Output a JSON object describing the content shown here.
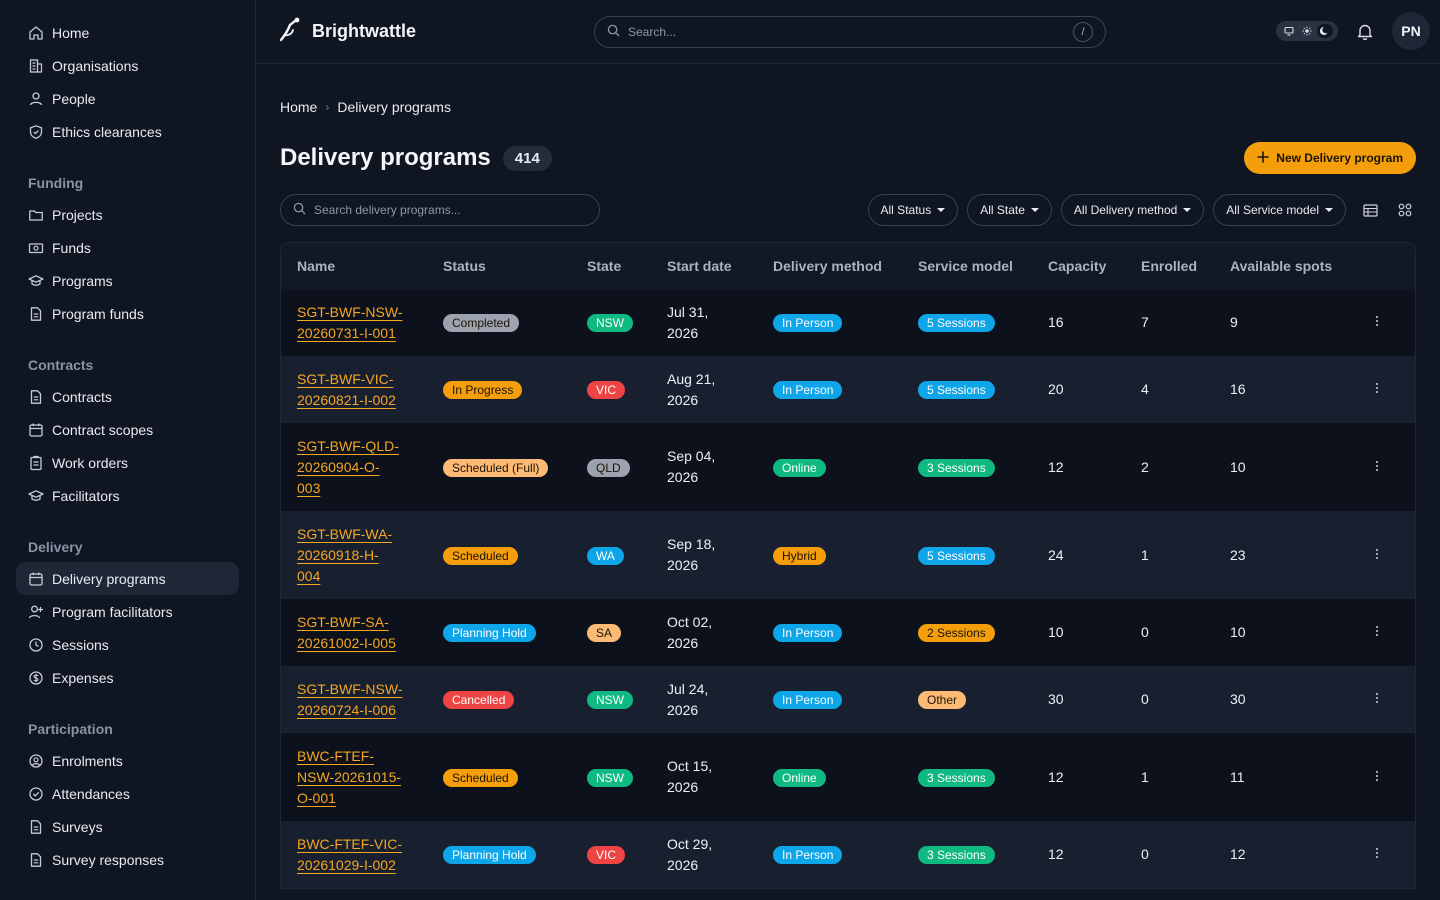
{
  "sidebar": {
    "top_items": [
      {
        "label": "Home",
        "icon": "home-icon"
      },
      {
        "label": "Organisations",
        "icon": "building-icon"
      },
      {
        "label": "People",
        "icon": "person-icon"
      },
      {
        "label": "Ethics clearances",
        "icon": "shield-icon"
      }
    ],
    "sections": [
      {
        "title": "Funding",
        "items": [
          {
            "label": "Projects",
            "icon": "folder-icon"
          },
          {
            "label": "Funds",
            "icon": "banknote-icon"
          },
          {
            "label": "Programs",
            "icon": "graduation-cap-icon"
          },
          {
            "label": "Program funds",
            "icon": "document-icon"
          }
        ]
      },
      {
        "title": "Contracts",
        "items": [
          {
            "label": "Contracts",
            "icon": "document-icon"
          },
          {
            "label": "Contract scopes",
            "icon": "calendar-icon"
          },
          {
            "label": "Work orders",
            "icon": "clipboard-icon"
          },
          {
            "label": "Facilitators",
            "icon": "graduation-cap-icon"
          }
        ]
      },
      {
        "title": "Delivery",
        "items": [
          {
            "label": "Delivery programs",
            "icon": "calendar-icon",
            "active": true
          },
          {
            "label": "Program facilitators",
            "icon": "user-plus-icon"
          },
          {
            "label": "Sessions",
            "icon": "clock-icon"
          },
          {
            "label": "Expenses",
            "icon": "dollar-circle-icon"
          }
        ]
      },
      {
        "title": "Participation",
        "items": [
          {
            "label": "Enrolments",
            "icon": "user-circle-icon"
          },
          {
            "label": "Attendances",
            "icon": "check-circle-icon"
          },
          {
            "label": "Surveys",
            "icon": "document-icon"
          },
          {
            "label": "Survey responses",
            "icon": "document-icon"
          }
        ]
      }
    ]
  },
  "topbar": {
    "brand": "Brightwattle",
    "search_placeholder": "Search...",
    "search_shortcut": "/",
    "avatar_initials": "PN"
  },
  "breadcrumb": {
    "home": "Home",
    "current": "Delivery programs"
  },
  "page": {
    "title": "Delivery programs",
    "count": "414",
    "new_button": "New Delivery program",
    "table_search_placeholder": "Search delivery programs..."
  },
  "filters": [
    "All Status",
    "All State",
    "All Delivery method",
    "All Service model"
  ],
  "table": {
    "headers": [
      "Name",
      "Status",
      "State",
      "Start date",
      "Delivery method",
      "Service model",
      "Capacity",
      "Enrolled",
      "Available spots"
    ],
    "rows": [
      {
        "name": [
          "SGT-BWF-NSW-",
          "20260731-I-001"
        ],
        "status": "Completed",
        "state": "NSW",
        "date": [
          "Jul 31,",
          "2026"
        ],
        "method": "In Person",
        "model": "5 Sessions",
        "capacity": "16",
        "enrolled": "7",
        "available": "9"
      },
      {
        "name": [
          "SGT-BWF-VIC-",
          "20260821-I-002"
        ],
        "status": "In Progress",
        "state": "VIC",
        "date": [
          "Aug 21,",
          "2026"
        ],
        "method": "In Person",
        "model": "5 Sessions",
        "capacity": "20",
        "enrolled": "4",
        "available": "16"
      },
      {
        "name": [
          "SGT-BWF-QLD-",
          "20260904-O-",
          "003"
        ],
        "status": "Scheduled (Full)",
        "state": "QLD",
        "date": [
          "Sep 04,",
          "2026"
        ],
        "method": "Online",
        "model": "3 Sessions",
        "capacity": "12",
        "enrolled": "2",
        "available": "10"
      },
      {
        "name": [
          "SGT-BWF-WA-",
          "20260918-H-",
          "004"
        ],
        "status": "Scheduled",
        "state": "WA",
        "date": [
          "Sep 18,",
          "2026"
        ],
        "method": "Hybrid",
        "model": "5 Sessions",
        "capacity": "24",
        "enrolled": "1",
        "available": "23"
      },
      {
        "name": [
          "SGT-BWF-SA-",
          "20261002-I-005"
        ],
        "status": "Planning Hold",
        "state": "SA",
        "date": [
          "Oct 02,",
          "2026"
        ],
        "method": "In Person",
        "model": "2 Sessions",
        "capacity": "10",
        "enrolled": "0",
        "available": "10"
      },
      {
        "name": [
          "SGT-BWF-NSW-",
          "20260724-I-006"
        ],
        "status": "Cancelled",
        "state": "NSW",
        "date": [
          "Jul 24,",
          "2026"
        ],
        "method": "In Person",
        "model": "Other",
        "capacity": "30",
        "enrolled": "0",
        "available": "30"
      },
      {
        "name": [
          "BWC-FTEF-",
          "NSW-20261015-",
          "O-001"
        ],
        "status": "Scheduled",
        "state": "NSW",
        "date": [
          "Oct 15,",
          "2026"
        ],
        "method": "Online",
        "model": "3 Sessions",
        "capacity": "12",
        "enrolled": "1",
        "available": "11"
      },
      {
        "name": [
          "BWC-FTEF-VIC-",
          "20261029-I-002"
        ],
        "status": "Planning Hold",
        "state": "VIC",
        "date": [
          "Oct 29,",
          "2026"
        ],
        "method": "In Person",
        "model": "3 Sessions",
        "capacity": "12",
        "enrolled": "0",
        "available": "12"
      }
    ]
  },
  "colors": {
    "accent": "#f59e0b",
    "status": {
      "Completed": "#9ca3af",
      "In Progress": "#f59e0b",
      "Scheduled (Full)": "#fdba74",
      "Scheduled": "#f59e0b",
      "Planning Hold": "#0ea5e9",
      "Cancelled": "#ef4444"
    },
    "state": {
      "NSW": "#10b981",
      "VIC": "#ef4444",
      "QLD": "#9ca3af",
      "WA": "#0ea5e9",
      "SA": "#fdba74"
    },
    "method": {
      "In Person": "#0ea5e9",
      "Online": "#10b981",
      "Hybrid": "#f59e0b"
    },
    "model": {
      "5 Sessions": "#0ea5e9",
      "3 Sessions": "#10b981",
      "2 Sessions": "#f59e0b",
      "Other": "#fdba74"
    }
  }
}
